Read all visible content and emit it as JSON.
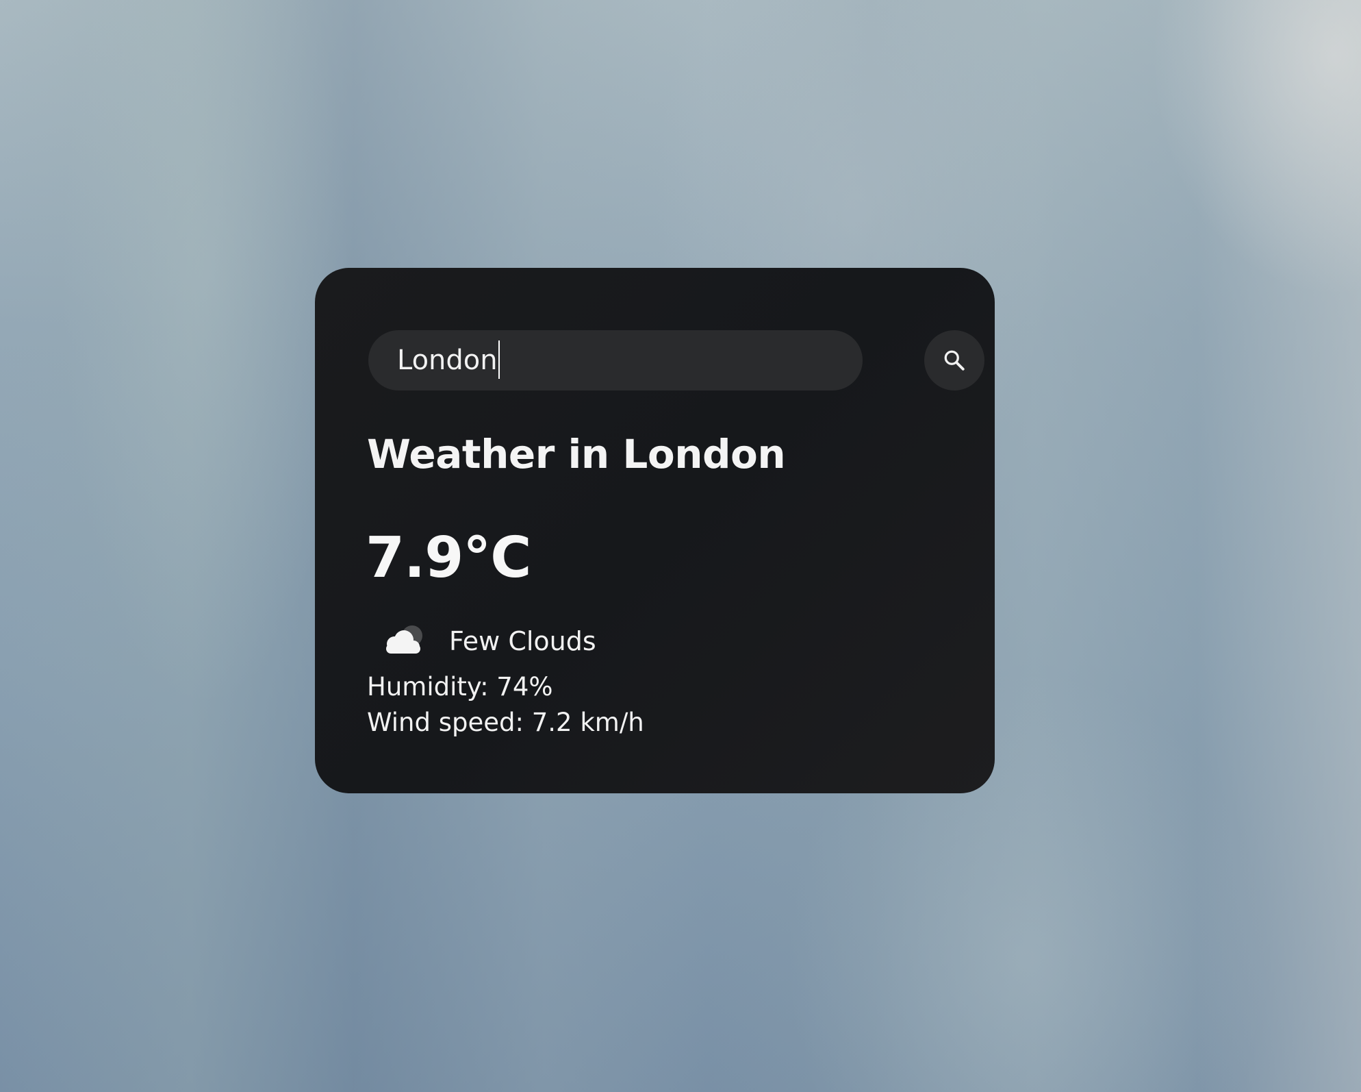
{
  "search": {
    "value": "London",
    "button_icon": "search-icon"
  },
  "weather": {
    "title": "Weather in London",
    "temperature": "7.9°C",
    "condition_icon": "few-clouds-icon",
    "condition": "Few Clouds",
    "humidity": "Humidity: 74%",
    "wind": "Wind speed: 7.2 km/h"
  },
  "colors": {
    "card_background": "#1a1b1d",
    "input_background": "#2a2b2d",
    "text": "#ffffff"
  }
}
